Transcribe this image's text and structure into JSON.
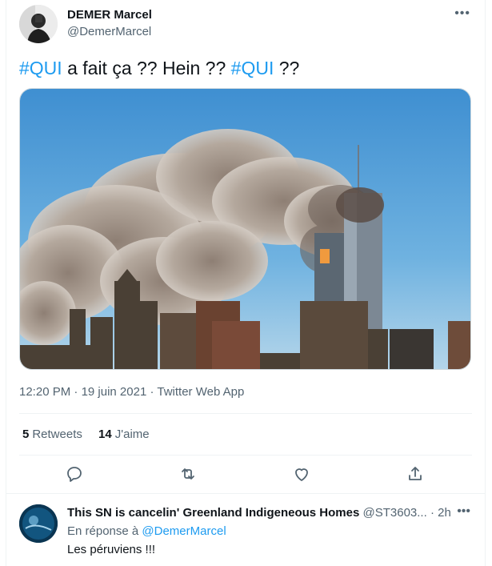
{
  "tweet": {
    "author_name": "DEMER Marcel",
    "author_handle": "@DemerMarcel",
    "more_icon": "more-horizontal-icon",
    "text_parts": {
      "hashtag1": "#QUI",
      "middle": " a fait ça ?? Hein ?? ",
      "hashtag2": "#QUI",
      "end": " ??"
    },
    "time": "12:20 PM",
    "separator": " · ",
    "date": "19 juin 2021",
    "source": "Twitter Web App",
    "retweets_count": "5",
    "retweets_label": "Retweets",
    "likes_count": "14",
    "likes_label": "J'aime",
    "actions": [
      "reply-icon",
      "retweet-icon",
      "like-icon",
      "share-icon"
    ]
  },
  "reply": {
    "author_name": "This SN is cancelin' Greenland Indigeneous Homes",
    "author_handle": "@ST3603...",
    "separator": " · ",
    "time": "2h",
    "in_reply_prefix": "En réponse à ",
    "in_reply_handle": "@DemerMarcel",
    "text": "Les péruviens !!!"
  },
  "colors": {
    "accent": "#1d9bf0",
    "secondary_text": "#536471",
    "primary_text": "#0f1419",
    "divider": "#eff3f4"
  }
}
